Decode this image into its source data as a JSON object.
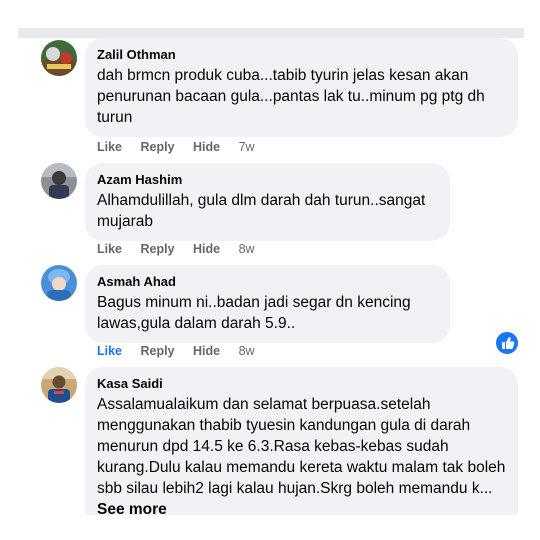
{
  "comments": [
    {
      "author": "Zalil Othman",
      "text": "dah brmcn produk cuba...tabib tyurin jelas kesan akan penurunan bacaan gula...pantas lak tu..minum pg ptg dh turun",
      "like": "Like",
      "reply": "Reply",
      "hide": "Hide",
      "time": "7w"
    },
    {
      "author": "Azam Hashim",
      "text": "Alhamdulillah, gula dlm darah dah turun..sangat mujarab",
      "like": "Like",
      "reply": "Reply",
      "hide": "Hide",
      "time": "8w"
    },
    {
      "author": "Asmah Ahad",
      "text": "Bagus minum ni..badan jadi segar dn kencing lawas,gula dalam darah 5.9..",
      "like": "Like",
      "reply": "Reply",
      "hide": "Hide",
      "time": "8w",
      "liked": true
    },
    {
      "author": "Kasa Saidi",
      "text": "Assalamualaikum dan selamat berpuasa.setelah menggunakan thabib tyuesin kandungan gula di darah menurun dpd 14.5 ke 6.3.Rasa kebas-kebas sudah kurang.Dulu kalau memandu kereta waktu malam tak boleh sbb silau lebih2 lagi kalau hujan.Skrg boleh memandu k...",
      "see_more": "See more"
    }
  ],
  "icons": {
    "reaction": "like-thumb-icon"
  },
  "colors": {
    "accent": "#1877f2",
    "bubble": "#f0f2f5",
    "meta": "#65676b"
  }
}
